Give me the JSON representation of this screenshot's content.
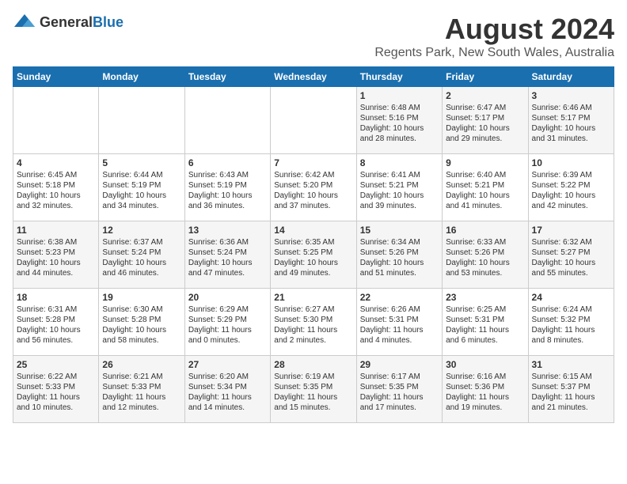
{
  "header": {
    "logo_general": "General",
    "logo_blue": "Blue",
    "title": "August 2024",
    "subtitle": "Regents Park, New South Wales, Australia"
  },
  "days_of_week": [
    "Sunday",
    "Monday",
    "Tuesday",
    "Wednesday",
    "Thursday",
    "Friday",
    "Saturday"
  ],
  "weeks": [
    {
      "days": [
        {
          "number": "",
          "content": ""
        },
        {
          "number": "",
          "content": ""
        },
        {
          "number": "",
          "content": ""
        },
        {
          "number": "",
          "content": ""
        },
        {
          "number": "1",
          "content": "Sunrise: 6:48 AM\nSunset: 5:16 PM\nDaylight: 10 hours and 28 minutes."
        },
        {
          "number": "2",
          "content": "Sunrise: 6:47 AM\nSunset: 5:17 PM\nDaylight: 10 hours and 29 minutes."
        },
        {
          "number": "3",
          "content": "Sunrise: 6:46 AM\nSunset: 5:17 PM\nDaylight: 10 hours and 31 minutes."
        }
      ]
    },
    {
      "days": [
        {
          "number": "4",
          "content": "Sunrise: 6:45 AM\nSunset: 5:18 PM\nDaylight: 10 hours and 32 minutes."
        },
        {
          "number": "5",
          "content": "Sunrise: 6:44 AM\nSunset: 5:19 PM\nDaylight: 10 hours and 34 minutes."
        },
        {
          "number": "6",
          "content": "Sunrise: 6:43 AM\nSunset: 5:19 PM\nDaylight: 10 hours and 36 minutes."
        },
        {
          "number": "7",
          "content": "Sunrise: 6:42 AM\nSunset: 5:20 PM\nDaylight: 10 hours and 37 minutes."
        },
        {
          "number": "8",
          "content": "Sunrise: 6:41 AM\nSunset: 5:21 PM\nDaylight: 10 hours and 39 minutes."
        },
        {
          "number": "9",
          "content": "Sunrise: 6:40 AM\nSunset: 5:21 PM\nDaylight: 10 hours and 41 minutes."
        },
        {
          "number": "10",
          "content": "Sunrise: 6:39 AM\nSunset: 5:22 PM\nDaylight: 10 hours and 42 minutes."
        }
      ]
    },
    {
      "days": [
        {
          "number": "11",
          "content": "Sunrise: 6:38 AM\nSunset: 5:23 PM\nDaylight: 10 hours and 44 minutes."
        },
        {
          "number": "12",
          "content": "Sunrise: 6:37 AM\nSunset: 5:24 PM\nDaylight: 10 hours and 46 minutes."
        },
        {
          "number": "13",
          "content": "Sunrise: 6:36 AM\nSunset: 5:24 PM\nDaylight: 10 hours and 47 minutes."
        },
        {
          "number": "14",
          "content": "Sunrise: 6:35 AM\nSunset: 5:25 PM\nDaylight: 10 hours and 49 minutes."
        },
        {
          "number": "15",
          "content": "Sunrise: 6:34 AM\nSunset: 5:26 PM\nDaylight: 10 hours and 51 minutes."
        },
        {
          "number": "16",
          "content": "Sunrise: 6:33 AM\nSunset: 5:26 PM\nDaylight: 10 hours and 53 minutes."
        },
        {
          "number": "17",
          "content": "Sunrise: 6:32 AM\nSunset: 5:27 PM\nDaylight: 10 hours and 55 minutes."
        }
      ]
    },
    {
      "days": [
        {
          "number": "18",
          "content": "Sunrise: 6:31 AM\nSunset: 5:28 PM\nDaylight: 10 hours and 56 minutes."
        },
        {
          "number": "19",
          "content": "Sunrise: 6:30 AM\nSunset: 5:28 PM\nDaylight: 10 hours and 58 minutes."
        },
        {
          "number": "20",
          "content": "Sunrise: 6:29 AM\nSunset: 5:29 PM\nDaylight: 11 hours and 0 minutes."
        },
        {
          "number": "21",
          "content": "Sunrise: 6:27 AM\nSunset: 5:30 PM\nDaylight: 11 hours and 2 minutes."
        },
        {
          "number": "22",
          "content": "Sunrise: 6:26 AM\nSunset: 5:31 PM\nDaylight: 11 hours and 4 minutes."
        },
        {
          "number": "23",
          "content": "Sunrise: 6:25 AM\nSunset: 5:31 PM\nDaylight: 11 hours and 6 minutes."
        },
        {
          "number": "24",
          "content": "Sunrise: 6:24 AM\nSunset: 5:32 PM\nDaylight: 11 hours and 8 minutes."
        }
      ]
    },
    {
      "days": [
        {
          "number": "25",
          "content": "Sunrise: 6:22 AM\nSunset: 5:33 PM\nDaylight: 11 hours and 10 minutes."
        },
        {
          "number": "26",
          "content": "Sunrise: 6:21 AM\nSunset: 5:33 PM\nDaylight: 11 hours and 12 minutes."
        },
        {
          "number": "27",
          "content": "Sunrise: 6:20 AM\nSunset: 5:34 PM\nDaylight: 11 hours and 14 minutes."
        },
        {
          "number": "28",
          "content": "Sunrise: 6:19 AM\nSunset: 5:35 PM\nDaylight: 11 hours and 15 minutes."
        },
        {
          "number": "29",
          "content": "Sunrise: 6:17 AM\nSunset: 5:35 PM\nDaylight: 11 hours and 17 minutes."
        },
        {
          "number": "30",
          "content": "Sunrise: 6:16 AM\nSunset: 5:36 PM\nDaylight: 11 hours and 19 minutes."
        },
        {
          "number": "31",
          "content": "Sunrise: 6:15 AM\nSunset: 5:37 PM\nDaylight: 11 hours and 21 minutes."
        }
      ]
    }
  ]
}
